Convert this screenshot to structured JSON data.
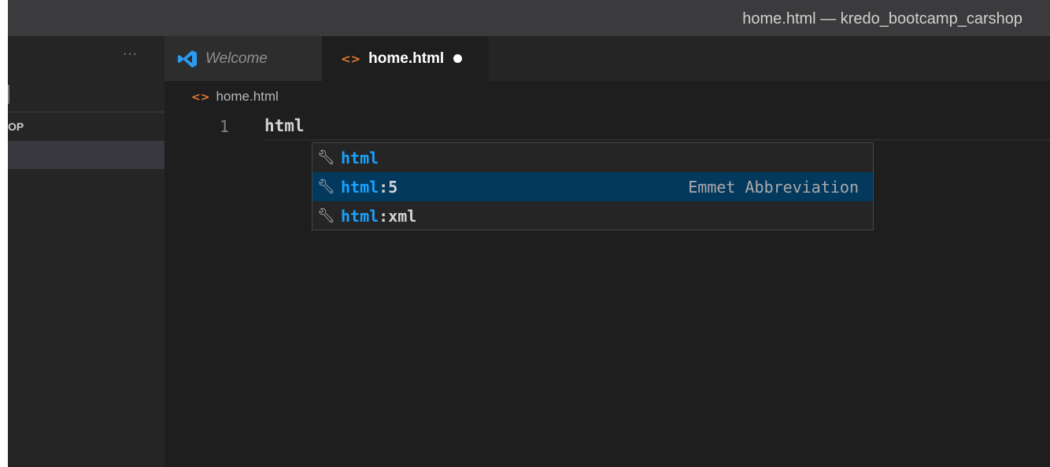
{
  "window": {
    "title": "home.html — kredo_bootcamp_carshop"
  },
  "sidebar": {
    "more_label": "···",
    "project_label": "OP"
  },
  "tabs": [
    {
      "label": "Welcome",
      "icon": "vscode-logo-icon",
      "active": false
    },
    {
      "label": "home.html",
      "icon": "html-file-icon",
      "active": true,
      "dirty": true
    }
  ],
  "editor": {
    "breadcrumb": {
      "icon": "html-file-icon",
      "label": "home.html"
    },
    "lines": [
      {
        "number": "1",
        "text": "html"
      }
    ]
  },
  "suggest": {
    "items": [
      {
        "match": "html",
        "rest": "",
        "detail": "",
        "icon": "wrench-icon",
        "selected": false
      },
      {
        "match": "html",
        "rest": ":5",
        "detail": "Emmet Abbreviation",
        "icon": "wrench-icon",
        "selected": true
      },
      {
        "match": "html",
        "rest": ":xml",
        "detail": "",
        "icon": "wrench-icon",
        "selected": false
      }
    ]
  },
  "colors": {
    "accent_match": "#18a3ff",
    "selected_row": "#04395e",
    "html_icon": "#e37933",
    "vscode_blue": "#2b9bf0"
  }
}
